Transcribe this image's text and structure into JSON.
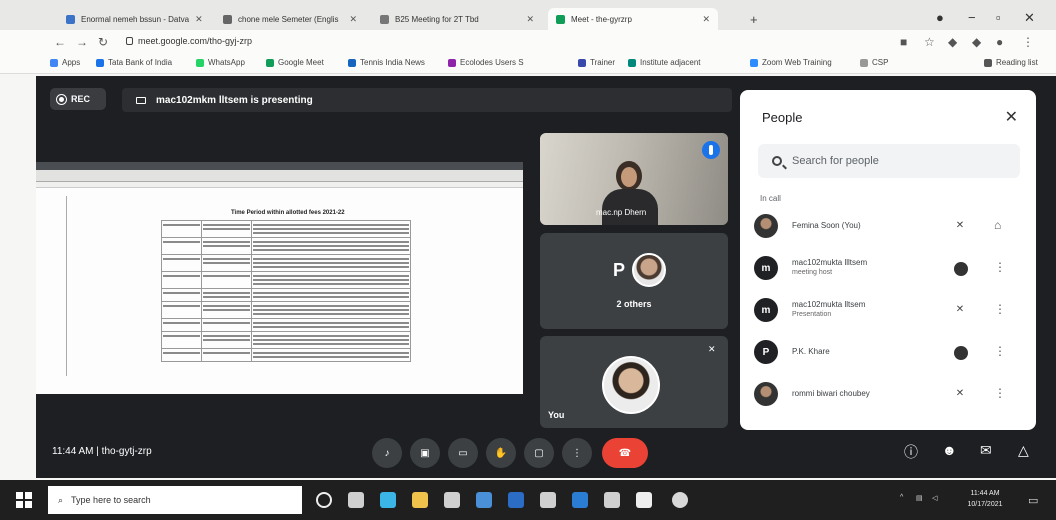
{
  "browser": {
    "tabs": [
      {
        "label": "Enormal nemeh bssun - Datva"
      },
      {
        "label": "chone mele Semeter (Englis"
      },
      {
        "label": "B25 Meeting for 2T Tbd"
      },
      {
        "label": "Meet - the-gyrzrp"
      }
    ],
    "url": "meet.google.com/tho-gyj-zrp",
    "bookmarks": [
      {
        "label": "Apps",
        "color": "#4285f4"
      },
      {
        "label": "Tata Bank of India",
        "color": "#1a73e8"
      },
      {
        "label": "WhatsApp",
        "color": "#25d366"
      },
      {
        "label": "Google Meet",
        "color": "#0f9d58"
      },
      {
        "label": "Tennis India News",
        "color": "#1565c0"
      },
      {
        "label": "Ecolodes Users S",
        "color": "#8e24aa"
      },
      {
        "label": "Trainer",
        "color": "#3949ab"
      },
      {
        "label": "Institute adjacent",
        "color": "#00897b"
      },
      {
        "label": "Zoom Web Training",
        "color": "#2d8cff"
      },
      {
        "label": "CSP",
        "color": "#999999"
      },
      {
        "label": "Reading list",
        "color": "#555555"
      }
    ]
  },
  "meet": {
    "rec_label": "REC",
    "presenting": "mac102mkm lltsem is presenting",
    "doc_title": "Time Period within allotted fees 2021-22",
    "camera_name": "mac.np Dhern",
    "others_initial": "P",
    "others_label": "2 others",
    "you_label": "You",
    "time_code": "11:44 AM  |  tho-gytj-zrp"
  },
  "people": {
    "title": "People",
    "search_placeholder": "Search for people",
    "section": "In call",
    "rows": [
      {
        "name": "Femina Soon (You)",
        "sub": "",
        "initial": "",
        "avatar": "photo"
      },
      {
        "name": "mac102mukta llltsem",
        "sub": "meeting host",
        "initial": "m",
        "avatar": "letter"
      },
      {
        "name": "mac102mukta lltsem",
        "sub": "Presentation",
        "initial": "m",
        "avatar": "letter"
      },
      {
        "name": "P.K. Khare",
        "sub": "",
        "initial": "P",
        "avatar": "letter"
      },
      {
        "name": "rommi biwari choubey",
        "sub": "",
        "initial": "",
        "avatar": "photo"
      }
    ]
  },
  "taskbar": {
    "search_placeholder": "Type here to search",
    "time": "11:44 AM",
    "date": "10/17/2021"
  }
}
